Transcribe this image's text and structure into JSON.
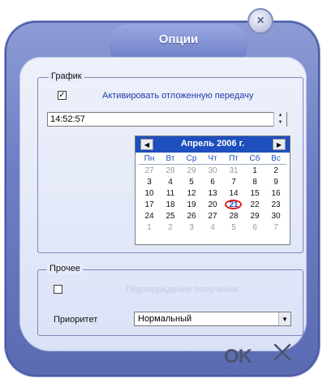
{
  "dialog": {
    "title": "Опции",
    "close_glyph": "×"
  },
  "schedule": {
    "group_label": "График",
    "checkbox_checked": true,
    "checkbox_glyph": "✓",
    "checkbox_label": "Активировать отложенную передачу",
    "time_value": "14:52:57"
  },
  "calendar": {
    "month_title": "Апрель 2006 г.",
    "prev_glyph": "◀",
    "next_glyph": "▶",
    "weekdays": [
      "Пн",
      "Вт",
      "Ср",
      "Чт",
      "Пт",
      "Сб",
      "Вс"
    ],
    "weeks": [
      [
        "27",
        "28",
        "29",
        "30",
        "31",
        "1",
        "2"
      ],
      [
        "3",
        "4",
        "5",
        "6",
        "7",
        "8",
        "9"
      ],
      [
        "10",
        "11",
        "12",
        "13",
        "14",
        "15",
        "16"
      ],
      [
        "17",
        "18",
        "19",
        "20",
        "21",
        "22",
        "23"
      ],
      [
        "24",
        "25",
        "26",
        "27",
        "28",
        "29",
        "30"
      ],
      [
        "1",
        "2",
        "3",
        "4",
        "5",
        "6",
        "7"
      ]
    ],
    "muted_days": {
      "week0": [
        0,
        1,
        2,
        3,
        4
      ],
      "week5": [
        0,
        1,
        2,
        3,
        4,
        5,
        6
      ]
    },
    "selected_day": "21"
  },
  "other": {
    "group_label": "Прочее",
    "checkbox_checked": false,
    "checkbox_label": "Подтверждение получения",
    "priority_label": "Приоритет",
    "priority_value": "Нормальный",
    "dropdown_glyph": "▼"
  },
  "actions": {
    "ok_label": "OK"
  },
  "icons": {
    "close": "close-icon",
    "ok": "ok-icon",
    "cancel": "cancel-icon",
    "calendar_prev": "chevron-left-icon",
    "calendar_next": "chevron-right-icon",
    "dropdown": "chevron-down-icon",
    "spin": "spinner-icon"
  }
}
